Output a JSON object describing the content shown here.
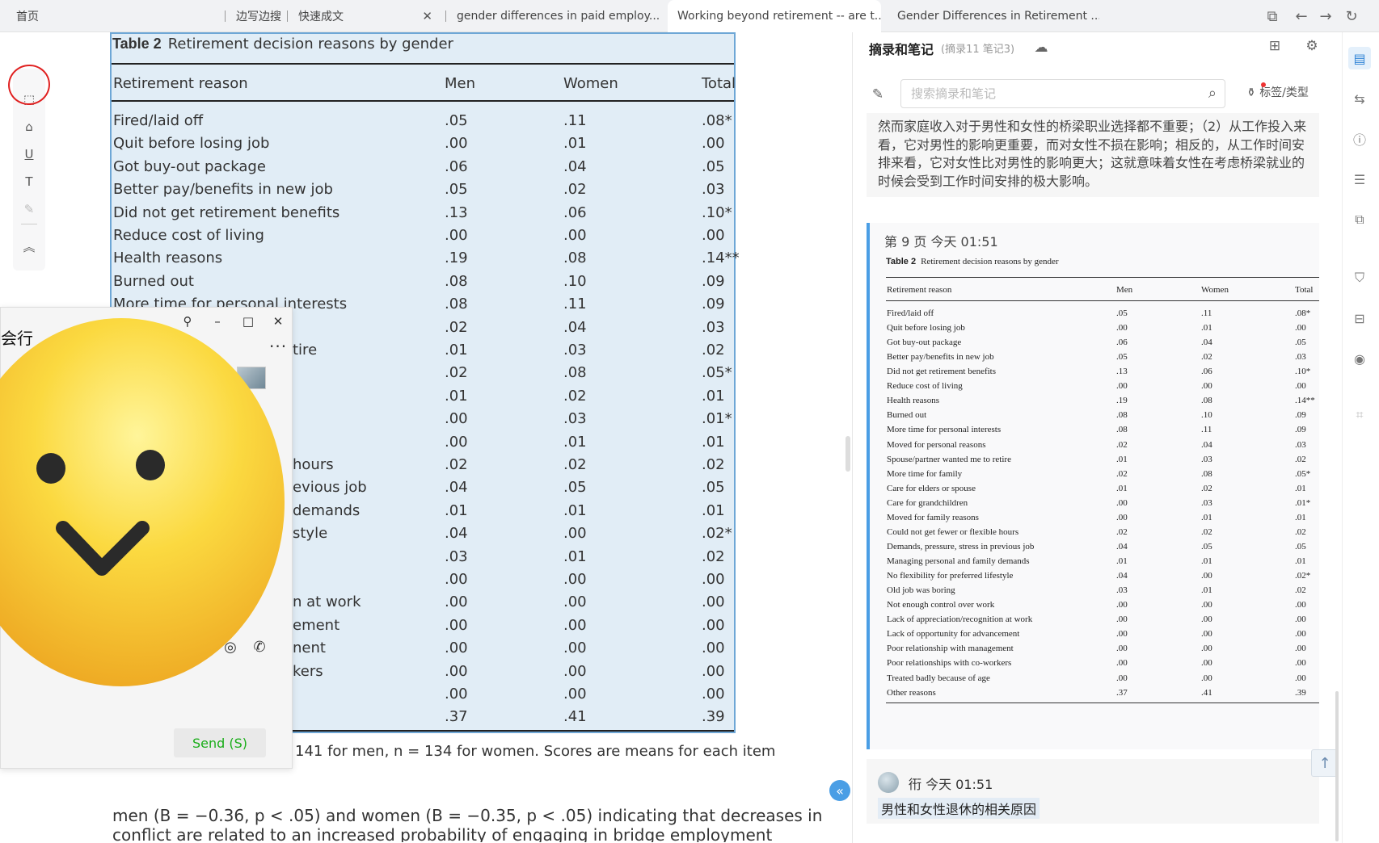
{
  "tabs": [
    {
      "label": "首页",
      "closable": false
    },
    {
      "label": "边写边搜",
      "closable": false
    },
    {
      "label": "快速成文",
      "closable": true
    },
    {
      "label": "gender differences in paid employ...",
      "closable": true
    },
    {
      "label": "Working beyond retirement -- are t...",
      "closable": true,
      "active": true
    },
    {
      "label": "Gender Differences in Retirement ...",
      "closable": true
    }
  ],
  "tools": [
    "select-icon",
    "highlight-icon",
    "underline-icon",
    "text-icon",
    "eraser-icon",
    "collapse-up-icon"
  ],
  "document": {
    "table_label": "Table 2",
    "table_title": "Retirement decision reasons by gender",
    "columns": [
      "Retirement reason",
      "Men",
      "Women",
      "Total"
    ],
    "rows": [
      [
        "Fired/laid off",
        ".05",
        ".11",
        ".08*"
      ],
      [
        "Quit before losing job",
        ".00",
        ".01",
        ".00"
      ],
      [
        "Got buy-out package",
        ".06",
        ".04",
        ".05"
      ],
      [
        "Better pay/benefits in new job",
        ".05",
        ".02",
        ".03"
      ],
      [
        "Did not get retirement benefits",
        ".13",
        ".06",
        ".10*"
      ],
      [
        "Reduce cost of living",
        ".00",
        ".00",
        ".00"
      ],
      [
        "Health reasons",
        ".19",
        ".08",
        ".14**"
      ],
      [
        "Burned out",
        ".08",
        ".10",
        ".09"
      ],
      [
        "More time for personal interests",
        ".08",
        ".11",
        ".09"
      ],
      [
        "",
        ".02",
        ".04",
        ".03"
      ],
      [
        "tire",
        ".01",
        ".03",
        ".02"
      ],
      [
        "",
        ".02",
        ".08",
        ".05*"
      ],
      [
        "",
        ".01",
        ".02",
        ".01"
      ],
      [
        "",
        ".00",
        ".03",
        ".01*"
      ],
      [
        "",
        ".00",
        ".01",
        ".01"
      ],
      [
        "hours",
        ".02",
        ".02",
        ".02"
      ],
      [
        "evious job",
        ".04",
        ".05",
        ".05"
      ],
      [
        "demands",
        ".01",
        ".01",
        ".01"
      ],
      [
        "style",
        ".04",
        ".00",
        ".02*"
      ],
      [
        "",
        ".03",
        ".01",
        ".02"
      ],
      [
        "",
        ".00",
        ".00",
        ".00"
      ],
      [
        "n at work",
        ".00",
        ".00",
        ".00"
      ],
      [
        "ement",
        ".00",
        ".00",
        ".00"
      ],
      [
        "nent",
        ".00",
        ".00",
        ".00"
      ],
      [
        "kers",
        ".00",
        ".00",
        ".00"
      ],
      [
        "",
        ".00",
        ".00",
        ".00"
      ],
      [
        "",
        ".37",
        ".41",
        ".39"
      ]
    ],
    "footnote": "141 for men, n = 134 for women. Scores are means for each item",
    "body_line1": "men (B = −0.36, p < .05) and women (B = −0.35, p < .05) indicating that decreases in",
    "body_line2": "conflict are related to an increased probability of engaging in bridge employment"
  },
  "chat": {
    "title_fragment": "会行",
    "more_label": "···",
    "send_label": "Send (S)"
  },
  "panel": {
    "title": "摘录和笔记",
    "counts": "(摘录11  笔记3)",
    "search_placeholder": "搜索摘录和笔记",
    "filter_label": "标签/类型",
    "card1_text": "然而家庭收入对于男性和女性的桥梁职业选择都不重要；（2）从工作投入来看，它对男性的影响更重要，而对女性不损在影响；相反的，从工作时间安排来看，它对女性比对男性的影响更大；这就意味着女性在考虑桥梁就业的时候会受到工作时间安排的极大影响。",
    "card2_meta": "第 9 页   今天 01:51",
    "card3_meta": "衎 今天 01:51",
    "card3_text": "男性和女性退休的相关原因",
    "mini_table": {
      "label": "Table 2",
      "title": "Retirement decision reasons by gender",
      "columns": [
        "Retirement reason",
        "Men",
        "Women",
        "Total"
      ],
      "rows": [
        [
          "Fired/laid off",
          ".05",
          ".11",
          ".08*"
        ],
        [
          "Quit before losing job",
          ".00",
          ".01",
          ".00"
        ],
        [
          "Got buy-out package",
          ".06",
          ".04",
          ".05"
        ],
        [
          "Better pay/benefits in new job",
          ".05",
          ".02",
          ".03"
        ],
        [
          "Did not get retirement benefits",
          ".13",
          ".06",
          ".10*"
        ],
        [
          "Reduce cost of living",
          ".00",
          ".00",
          ".00"
        ],
        [
          "Health reasons",
          ".19",
          ".08",
          ".14**"
        ],
        [
          "Burned out",
          ".08",
          ".10",
          ".09"
        ],
        [
          "More time for personal interests",
          ".08",
          ".11",
          ".09"
        ],
        [
          "Moved for personal reasons",
          ".02",
          ".04",
          ".03"
        ],
        [
          "Spouse/partner wanted me to retire",
          ".01",
          ".03",
          ".02"
        ],
        [
          "More time for family",
          ".02",
          ".08",
          ".05*"
        ],
        [
          "Care for elders or spouse",
          ".01",
          ".02",
          ".01"
        ],
        [
          "Care for grandchildren",
          ".00",
          ".03",
          ".01*"
        ],
        [
          "Moved for family reasons",
          ".00",
          ".01",
          ".01"
        ],
        [
          "Could not get fewer or flexible hours",
          ".02",
          ".02",
          ".02"
        ],
        [
          "Demands, pressure, stress in previous job",
          ".04",
          ".05",
          ".05"
        ],
        [
          "Managing personal and family demands",
          ".01",
          ".01",
          ".01"
        ],
        [
          "No flexibility for preferred lifestyle",
          ".04",
          ".00",
          ".02*"
        ],
        [
          "Old job was boring",
          ".03",
          ".01",
          ".02"
        ],
        [
          "Not enough control over work",
          ".00",
          ".00",
          ".00"
        ],
        [
          "Lack of appreciation/recognition at work",
          ".00",
          ".00",
          ".00"
        ],
        [
          "Lack of opportunity for advancement",
          ".00",
          ".00",
          ".00"
        ],
        [
          "Poor relationship with management",
          ".00",
          ".00",
          ".00"
        ],
        [
          "Poor relationships with co-workers",
          ".00",
          ".00",
          ".00"
        ],
        [
          "Treated badly because of age",
          ".00",
          ".00",
          ".00"
        ],
        [
          "Other reasons",
          ".37",
          ".41",
          ".39"
        ]
      ]
    }
  },
  "rail": [
    "notes-icon",
    "translate-icon",
    "info-icon",
    "search-doc-icon",
    "copy-icon",
    "bookmark-icon",
    "book-icon",
    "ai-icon",
    "scan-icon"
  ]
}
